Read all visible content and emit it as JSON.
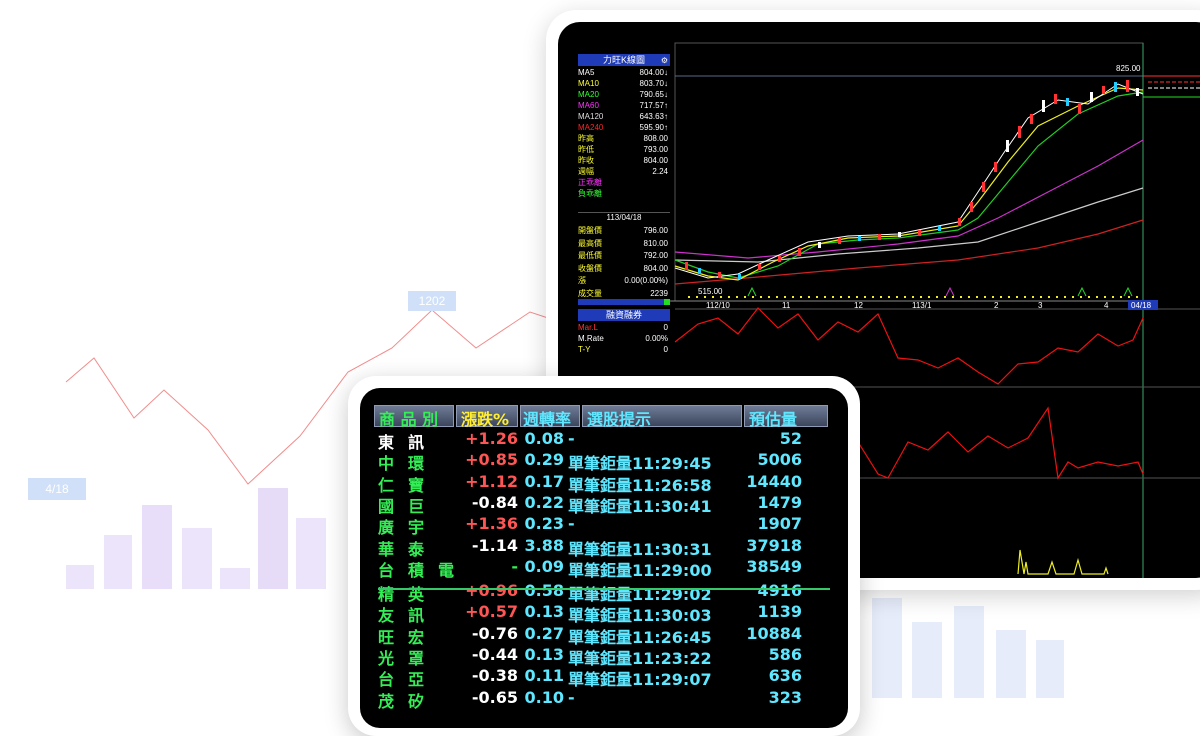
{
  "background": {
    "top_label": "1202",
    "date_label": "4/18",
    "line_color": "#f28c8c",
    "bar_color": "#e6dcf8"
  },
  "kline": {
    "title": "力旺K線圖",
    "gear_icon": "gear-icon",
    "ma": [
      {
        "name": "MA5",
        "value": "804.00↓",
        "color": "#ffffff"
      },
      {
        "name": "MA10",
        "value": "803.70↓",
        "color": "#ffff33"
      },
      {
        "name": "MA20",
        "value": "790.65↓",
        "color": "#33ff33"
      },
      {
        "name": "MA60",
        "value": "717.57↑",
        "color": "#ff33ff"
      },
      {
        "name": "MA120",
        "value": "643.63↑",
        "color": "#dddddd"
      },
      {
        "name": "MA240",
        "value": "595.90↑",
        "color": "#ff2222"
      },
      {
        "name": "昨高",
        "value": "808.00",
        "color": "#ffff33"
      },
      {
        "name": "昨低",
        "value": "793.00",
        "color": "#ffff33"
      },
      {
        "name": "昨收",
        "value": "804.00",
        "color": "#ffff33"
      },
      {
        "name": "週幅",
        "value": "2.24",
        "color": "#ffff33"
      },
      {
        "name": "正乖離",
        "value": "",
        "color": "#ff33ff"
      },
      {
        "name": "負乖離",
        "value": "",
        "color": "#33ff33"
      }
    ],
    "date": "113/04/18",
    "day": [
      {
        "name": "開盤價",
        "value": "796.00"
      },
      {
        "name": "最高價",
        "value": "810.00"
      },
      {
        "name": "最低價",
        "value": "792.00"
      },
      {
        "name": "收盤價",
        "value": "804.00"
      },
      {
        "name": "漲",
        "value": "0.00(0.00%)"
      },
      {
        "name": "成交量",
        "value": "2239"
      }
    ],
    "high_label": "825.00",
    "low_label": "515.00",
    "x_labels": [
      "112/10",
      "11",
      "12",
      "113/1",
      "2",
      "3",
      "4",
      "04/18"
    ],
    "indicator": {
      "title": "融資融券",
      "rows": [
        {
          "name": "Mar.L",
          "value": "0",
          "color": "#ff3333"
        },
        {
          "name": "M.Rate",
          "value": "0.00%",
          "color": "#ffffff"
        },
        {
          "name": "T-Y",
          "value": "0",
          "color": "#ffff33"
        }
      ]
    }
  },
  "quote": {
    "headers": [
      {
        "label": "商 品 別",
        "color": "#33ee55"
      },
      {
        "label": "漲跌%",
        "color": "#ffee33"
      },
      {
        "label": "週轉率",
        "color": "#5fe7ff"
      },
      {
        "label": "選股提示",
        "color": "#5fe7ff"
      },
      {
        "label": "預估量",
        "color": "#5fe7ff"
      }
    ],
    "rows": [
      {
        "name": "東訊",
        "change": "+1.26",
        "turnover": "0.08",
        "tip": "-",
        "volume": "52",
        "name_color": "#ffffff",
        "change_color": "#ff5555"
      },
      {
        "name": "中環",
        "change": "+0.85",
        "turnover": "0.29",
        "tip": "單筆鉅量11:29:45",
        "volume": "5006",
        "name_color": "#33ee55",
        "change_color": "#ff5555"
      },
      {
        "name": "仁寶",
        "change": "+1.12",
        "turnover": "0.17",
        "tip": "單筆鉅量11:26:58",
        "volume": "14440",
        "name_color": "#33ee55",
        "change_color": "#ff5555"
      },
      {
        "name": "國巨",
        "change": "-0.84",
        "turnover": "0.22",
        "tip": "單筆鉅量11:30:41",
        "volume": "1479",
        "name_color": "#33ee55",
        "change_color": "#ffffff"
      },
      {
        "name": "廣宇",
        "change": "+1.36",
        "turnover": "0.23",
        "tip": "-",
        "volume": "1907",
        "name_color": "#33ee55",
        "change_color": "#ff5555"
      },
      {
        "name": "華泰",
        "change": "-1.14",
        "turnover": "3.88",
        "tip": "單筆鉅量11:30:31",
        "volume": "37918",
        "name_color": "#33ee55",
        "change_color": "#ffffff"
      },
      {
        "name": "台積電",
        "change": "-",
        "turnover": "0.09",
        "tip": "單筆鉅量11:29:00",
        "volume": "38549",
        "name_color": "#33ee55",
        "change_color": "#33ee55"
      },
      {
        "name": "精英",
        "change": "+0.96",
        "turnover": "0.58",
        "tip": "單筆鉅量11:29:02",
        "volume": "4916",
        "name_color": "#33ee55",
        "change_color": "#ff5555"
      },
      {
        "name": "友訊",
        "change": "+0.57",
        "turnover": "0.13",
        "tip": "單筆鉅量11:30:03",
        "volume": "1139",
        "name_color": "#33ee55",
        "change_color": "#ff5555"
      },
      {
        "name": "旺宏",
        "change": "-0.76",
        "turnover": "0.27",
        "tip": "單筆鉅量11:26:45",
        "volume": "10884",
        "name_color": "#33ee55",
        "change_color": "#ffffff"
      },
      {
        "name": "光罩",
        "change": "-0.44",
        "turnover": "0.13",
        "tip": "單筆鉅量11:23:22",
        "volume": "586",
        "name_color": "#33ee55",
        "change_color": "#ffffff"
      },
      {
        "name": "台亞",
        "change": "-0.38",
        "turnover": "0.11",
        "tip": "單筆鉅量11:29:07",
        "volume": "636",
        "name_color": "#33ee55",
        "change_color": "#ffffff"
      },
      {
        "name": "茂矽",
        "change": "-0.65",
        "turnover": "0.10",
        "tip": "-",
        "volume": "323",
        "name_color": "#33ee55",
        "change_color": "#ffffff"
      }
    ]
  }
}
